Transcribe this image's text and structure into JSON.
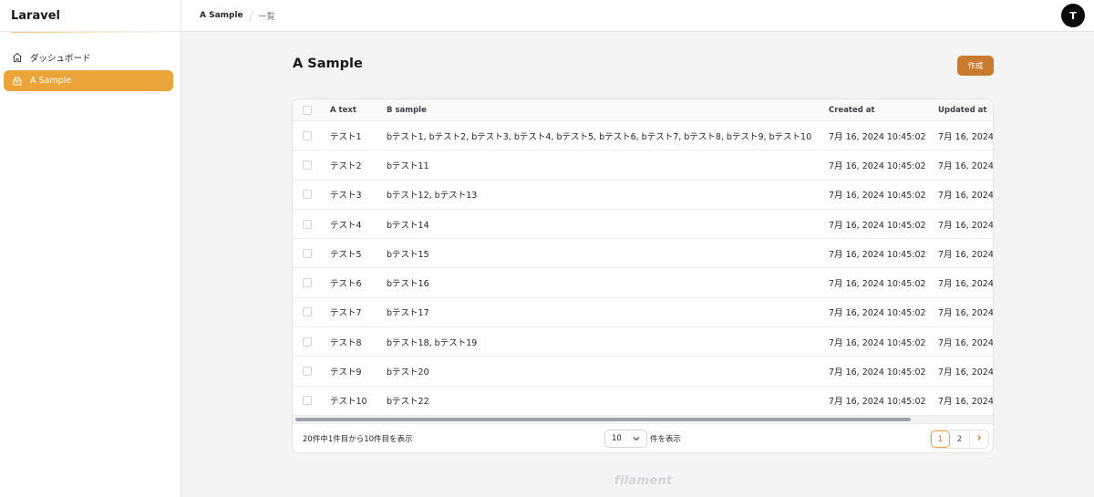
{
  "app": {
    "brand": "Laravel"
  },
  "sidebar": {
    "items": [
      {
        "label": "ダッシュボード",
        "icon": "home-icon",
        "active": false
      },
      {
        "label": "A Sample",
        "icon": "box-icon",
        "active": true
      }
    ]
  },
  "topbar": {
    "breadcrumbs": [
      "A Sample",
      "一覧"
    ],
    "avatar_initial": "T"
  },
  "page": {
    "title": "A Sample",
    "create_label": "作成"
  },
  "table": {
    "columns": [
      "A text",
      "B sample",
      "Created at",
      "Updated at"
    ],
    "rows": [
      {
        "a": "テスト1",
        "b": "bテスト1, bテスト2, bテスト3, bテスト4, bテスト5, bテスト6, bテスト7, bテスト8, bテスト9, bテスト10",
        "created": "7月 16, 2024 10:45:02",
        "updated": "7月 16, 2024"
      },
      {
        "a": "テスト2",
        "b": "bテスト11",
        "created": "7月 16, 2024 10:45:02",
        "updated": "7月 16, 2024"
      },
      {
        "a": "テスト3",
        "b": "bテスト12, bテスト13",
        "created": "7月 16, 2024 10:45:02",
        "updated": "7月 16, 2024"
      },
      {
        "a": "テスト4",
        "b": "bテスト14",
        "created": "7月 16, 2024 10:45:02",
        "updated": "7月 16, 2024"
      },
      {
        "a": "テスト5",
        "b": "bテスト15",
        "created": "7月 16, 2024 10:45:02",
        "updated": "7月 16, 2024"
      },
      {
        "a": "テスト6",
        "b": "bテスト16",
        "created": "7月 16, 2024 10:45:02",
        "updated": "7月 16, 2024"
      },
      {
        "a": "テスト7",
        "b": "bテスト17",
        "created": "7月 16, 2024 10:45:02",
        "updated": "7月 16, 2024"
      },
      {
        "a": "テスト8",
        "b": "bテスト18, bテスト19",
        "created": "7月 16, 2024 10:45:02",
        "updated": "7月 16, 2024"
      },
      {
        "a": "テスト9",
        "b": "bテスト20",
        "created": "7月 16, 2024 10:45:02",
        "updated": "7月 16, 2024"
      },
      {
        "a": "テスト10",
        "b": "bテスト22",
        "created": "7月 16, 2024 10:45:02",
        "updated": "7月 16, 2024"
      }
    ]
  },
  "footer": {
    "summary": "20件中1件目から10件目を表示",
    "per_page": "10",
    "per_page_label": "件を表示",
    "pages": [
      "1",
      "2"
    ],
    "current_page": "1"
  },
  "branding_footer": "filament",
  "colors": {
    "primary": "#eba43a",
    "primary_dark": "#c87a2f"
  }
}
